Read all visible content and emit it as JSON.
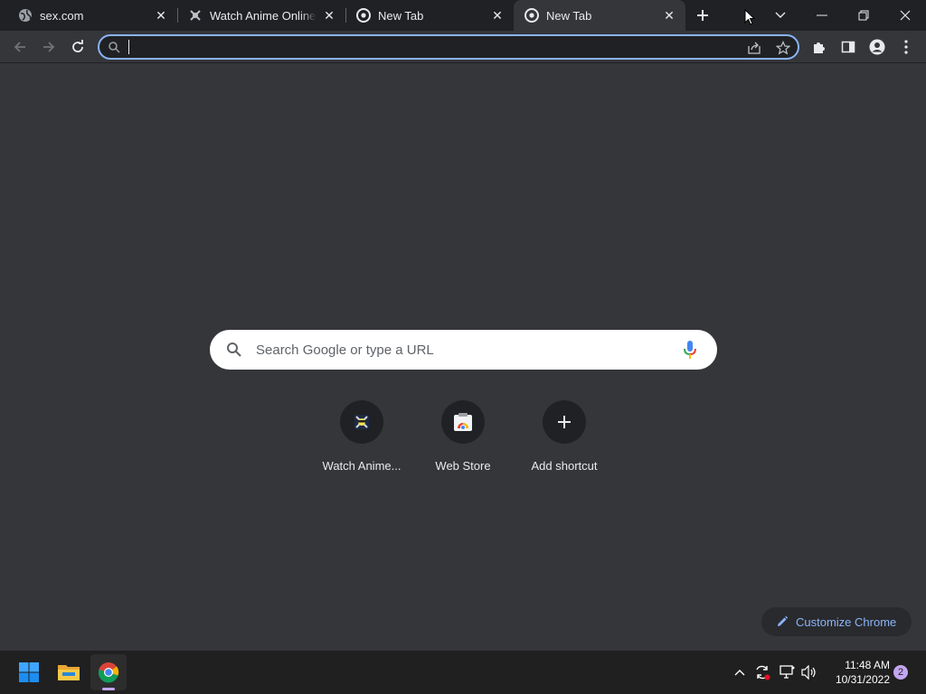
{
  "tabs": [
    {
      "title": "sex.com",
      "icon": "globe-icon"
    },
    {
      "title": "Watch Anime Online, Free Anime Streaming",
      "icon": "anime-site-icon"
    },
    {
      "title": "New Tab",
      "icon": "chrome-icon"
    },
    {
      "title": "New Tab",
      "icon": "chrome-icon",
      "active": true
    }
  ],
  "omnibox": {
    "value": "",
    "placeholder": ""
  },
  "search": {
    "placeholder": "Search Google or type a URL"
  },
  "shortcuts": [
    {
      "label": "Watch Anime...",
      "icon": "anime-site-icon"
    },
    {
      "label": "Web Store",
      "icon": "web-store-icon"
    },
    {
      "label": "Add shortcut",
      "icon": "plus-icon"
    }
  ],
  "customize": {
    "label": "Customize Chrome"
  },
  "taskbar": {
    "time": "11:48 AM",
    "date": "10/31/2022",
    "notifications": "2"
  },
  "colors": {
    "accent": "#8ab4f8",
    "background": "#35363a",
    "tabstrip": "#202124"
  }
}
